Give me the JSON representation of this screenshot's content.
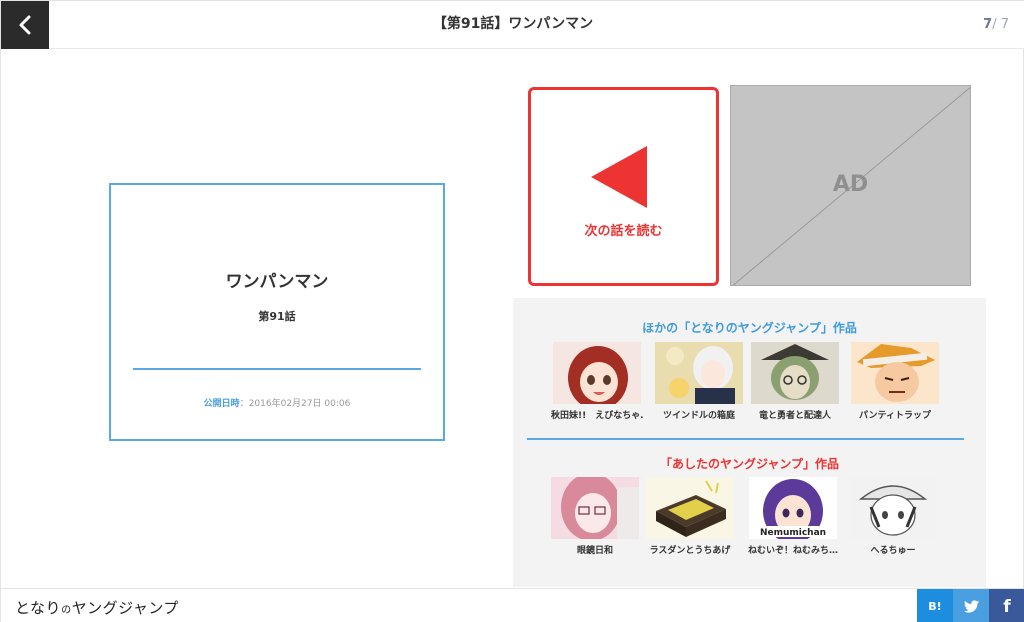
{
  "header": {
    "title": "【第91話】ワンパンマン",
    "page_current": "7",
    "page_sep": "/ ",
    "page_total": "7"
  },
  "end_card": {
    "series_title": "ワンパンマン",
    "episode": "第91話",
    "date_label": "公開日時",
    "date_sep": "：",
    "date_value": "2016年02月27日 00:06"
  },
  "next_episode": {
    "label": "次の話を読む",
    "color": "#ee3333"
  },
  "ad": {
    "label": "AD"
  },
  "recommendations": {
    "other_heading": "ほかの「となりのヤングジャンプ」作品",
    "other_items": [
      {
        "title": "秋田妹!!　えびなちゃ…",
        "icon": "manga-thumbnail"
      },
      {
        "title": "ツインドルの箱庭",
        "icon": "manga-thumbnail"
      },
      {
        "title": "竜と勇者と配達人",
        "icon": "manga-thumbnail"
      },
      {
        "title": "パンティトラップ",
        "icon": "manga-thumbnail"
      }
    ],
    "tomorrow_heading": "「あしたのヤングジャンプ」作品",
    "tomorrow_items": [
      {
        "title": "眼鏡日和",
        "icon": "manga-thumbnail"
      },
      {
        "title": "ラスダンとうちあげ",
        "icon": "manga-thumbnail"
      },
      {
        "title": "ねむいぞ！ねむみち…",
        "icon": "manga-thumbnail",
        "overlay_text": "Nemumichan"
      },
      {
        "title": "へるちゅー",
        "icon": "manga-thumbnail"
      }
    ]
  },
  "footer": {
    "logo_part1": "となり",
    "logo_part2": "の",
    "logo_part3": "ヤングジャンプ",
    "share_hatena": "B!",
    "share_facebook": "f"
  },
  "colors": {
    "accent_blue": "#5aa9e6",
    "accent_red": "#ee3333",
    "hatena": "#1d8de0",
    "twitter": "#4a9fe0",
    "facebook": "#39599b"
  }
}
